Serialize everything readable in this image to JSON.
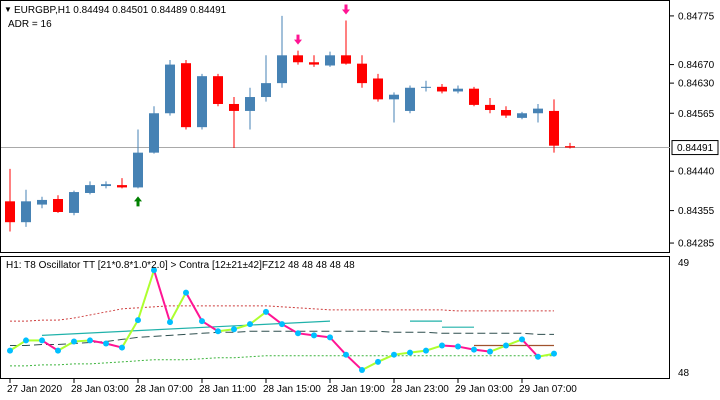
{
  "header": {
    "symbol_line": "EURGBP,H1  0.84494 0.84501 0.84489 0.84491",
    "indicator_line": "ADR = 16"
  },
  "subwindow": {
    "title": "H1: T8 Oscillator TT [21*0.8*1.0*2.0] > Contra [12±21±42]FZ12 48 48 48 48 48",
    "scale_top": "49",
    "scale_bottom": "48"
  },
  "current_price_label": "0.84491",
  "colors": {
    "bull": "#4682b4",
    "bear": "#ff0000",
    "up_arrow": "#008000",
    "down_arrow": "#ff1493",
    "osc_up": "#adff2f",
    "osc_down": "#ff1493",
    "osc_dot": "#00bfff",
    "upper_band": "#cd3c3c",
    "lower_band": "#3cb43c",
    "mid_line": "#2f4f4f",
    "teal_line": "#20b2aa",
    "brown_line": "#a0522d"
  },
  "chart_data": {
    "type": "candlestick",
    "timeframe": "H1",
    "y_ticks": [
      0.84775,
      0.8467,
      0.8463,
      0.84565,
      0.8444,
      0.84355,
      0.84285
    ],
    "ylim": [
      0.8427,
      0.84805
    ],
    "current_price": 0.84491,
    "x_tick_labels": [
      "27 Jan 2020",
      "28 Jan 03:00",
      "28 Jan 07:00",
      "28 Jan 11:00",
      "28 Jan 15:00",
      "28 Jan 19:00",
      "28 Jan 23:00",
      "29 Jan 03:00",
      "29 Jan 07:00"
    ],
    "candles": [
      {
        "o": 0.84375,
        "h": 0.84445,
        "l": 0.8431,
        "c": 0.8433
      },
      {
        "o": 0.8433,
        "h": 0.844,
        "l": 0.8432,
        "c": 0.84375
      },
      {
        "o": 0.84368,
        "h": 0.84385,
        "l": 0.8436,
        "c": 0.84378
      },
      {
        "o": 0.8438,
        "h": 0.84388,
        "l": 0.8435,
        "c": 0.84352
      },
      {
        "o": 0.8435,
        "h": 0.84398,
        "l": 0.84345,
        "c": 0.84395
      },
      {
        "o": 0.84393,
        "h": 0.84418,
        "l": 0.8439,
        "c": 0.8441
      },
      {
        "o": 0.84408,
        "h": 0.84418,
        "l": 0.84403,
        "c": 0.84412
      },
      {
        "o": 0.8441,
        "h": 0.84425,
        "l": 0.84403,
        "c": 0.84405
      },
      {
        "o": 0.84405,
        "h": 0.8453,
        "l": 0.84403,
        "c": 0.8448
      },
      {
        "o": 0.8448,
        "h": 0.8458,
        "l": 0.84478,
        "c": 0.84565
      },
      {
        "o": 0.84565,
        "h": 0.8468,
        "l": 0.8456,
        "c": 0.8467
      },
      {
        "o": 0.84673,
        "h": 0.8468,
        "l": 0.8453,
        "c": 0.84535
      },
      {
        "o": 0.84535,
        "h": 0.8465,
        "l": 0.8453,
        "c": 0.84645
      },
      {
        "o": 0.84645,
        "h": 0.8465,
        "l": 0.8458,
        "c": 0.84585
      },
      {
        "o": 0.84585,
        "h": 0.846,
        "l": 0.8449,
        "c": 0.8457
      },
      {
        "o": 0.8457,
        "h": 0.8462,
        "l": 0.8453,
        "c": 0.846
      },
      {
        "o": 0.846,
        "h": 0.8469,
        "l": 0.8459,
        "c": 0.8463
      },
      {
        "o": 0.8463,
        "h": 0.84775,
        "l": 0.8462,
        "c": 0.8469
      },
      {
        "o": 0.8469,
        "h": 0.847,
        "l": 0.8467,
        "c": 0.84675
      },
      {
        "o": 0.84675,
        "h": 0.8469,
        "l": 0.84665,
        "c": 0.8467
      },
      {
        "o": 0.84668,
        "h": 0.84698,
        "l": 0.84665,
        "c": 0.8469
      },
      {
        "o": 0.8469,
        "h": 0.84765,
        "l": 0.8467,
        "c": 0.84672
      },
      {
        "o": 0.84672,
        "h": 0.8469,
        "l": 0.8462,
        "c": 0.8463
      },
      {
        "o": 0.8464,
        "h": 0.8465,
        "l": 0.8459,
        "c": 0.84595
      },
      {
        "o": 0.84595,
        "h": 0.8461,
        "l": 0.84545,
        "c": 0.84605
      },
      {
        "o": 0.8457,
        "h": 0.84625,
        "l": 0.84565,
        "c": 0.8462
      },
      {
        "o": 0.84621,
        "h": 0.84635,
        "l": 0.84612,
        "c": 0.84622
      },
      {
        "o": 0.84622,
        "h": 0.84628,
        "l": 0.84608,
        "c": 0.84612
      },
      {
        "o": 0.84612,
        "h": 0.84625,
        "l": 0.84608,
        "c": 0.84618
      },
      {
        "o": 0.84618,
        "h": 0.84622,
        "l": 0.8458,
        "c": 0.84583
      },
      {
        "o": 0.84583,
        "h": 0.84598,
        "l": 0.84565,
        "c": 0.84572
      },
      {
        "o": 0.84572,
        "h": 0.8458,
        "l": 0.84555,
        "c": 0.8456
      },
      {
        "o": 0.84555,
        "h": 0.84568,
        "l": 0.84552,
        "c": 0.84565
      },
      {
        "o": 0.84565,
        "h": 0.84585,
        "l": 0.84545,
        "c": 0.84575
      },
      {
        "o": 0.8457,
        "h": 0.84595,
        "l": 0.8448,
        "c": 0.84495
      },
      {
        "o": 0.84494,
        "h": 0.84501,
        "l": 0.84489,
        "c": 0.84491
      }
    ],
    "up_arrows": [
      8
    ],
    "down_arrows": [
      18,
      21
    ],
    "oscillator": {
      "ylim": [
        48,
        49.1
      ],
      "values": [
        48.21,
        48.31,
        48.31,
        48.21,
        48.3,
        48.31,
        48.28,
        48.24,
        48.51,
        49.0,
        48.49,
        48.78,
        48.5,
        48.4,
        48.42,
        48.47,
        48.59,
        48.47,
        48.38,
        48.36,
        48.34,
        48.17,
        48.02,
        48.1,
        48.17,
        48.19,
        48.21,
        48.26,
        48.25,
        48.22,
        48.2,
        48.26,
        48.32,
        48.15,
        48.18
      ],
      "upper_band": [
        48.5,
        48.5,
        48.51,
        48.51,
        48.53,
        48.56,
        48.59,
        48.62,
        48.63,
        48.64,
        48.65,
        48.65,
        48.65,
        48.65,
        48.65,
        48.65,
        48.65,
        48.64,
        48.63,
        48.62,
        48.61,
        48.61,
        48.61,
        48.61,
        48.61,
        48.61,
        48.61,
        48.61,
        48.6,
        48.6,
        48.6,
        48.6,
        48.6,
        48.6,
        48.6
      ],
      "lower_band": [
        48.06,
        48.06,
        48.07,
        48.07,
        48.08,
        48.08,
        48.09,
        48.1,
        48.11,
        48.12,
        48.12,
        48.12,
        48.13,
        48.14,
        48.14,
        48.15,
        48.16,
        48.16,
        48.16,
        48.16,
        48.16,
        48.16,
        48.16,
        48.16,
        48.16,
        48.16,
        48.16,
        48.16,
        48.16,
        48.16,
        48.16,
        48.16,
        48.16,
        48.16,
        48.16
      ],
      "mid_line": [
        48.26,
        48.26,
        48.27,
        48.27,
        48.28,
        48.29,
        48.3,
        48.32,
        48.34,
        48.35,
        48.36,
        48.37,
        48.38,
        48.39,
        48.39,
        48.4,
        48.4,
        48.4,
        48.4,
        48.4,
        48.4,
        48.4,
        48.4,
        48.4,
        48.39,
        48.39,
        48.39,
        48.38,
        48.38,
        48.38,
        48.38,
        48.38,
        48.38,
        48.37,
        48.37
      ],
      "teal_segments": [
        {
          "from": 2,
          "to": 20,
          "start": 48.36,
          "end": 48.5
        },
        {
          "from": 25,
          "to": 27,
          "start": 48.5,
          "end": 48.5
        },
        {
          "from": 27,
          "to": 29,
          "start": 48.44,
          "end": 48.44
        }
      ],
      "brown_segment": {
        "from": 29,
        "to": 34,
        "start": 48.26,
        "end": 48.26
      }
    }
  }
}
